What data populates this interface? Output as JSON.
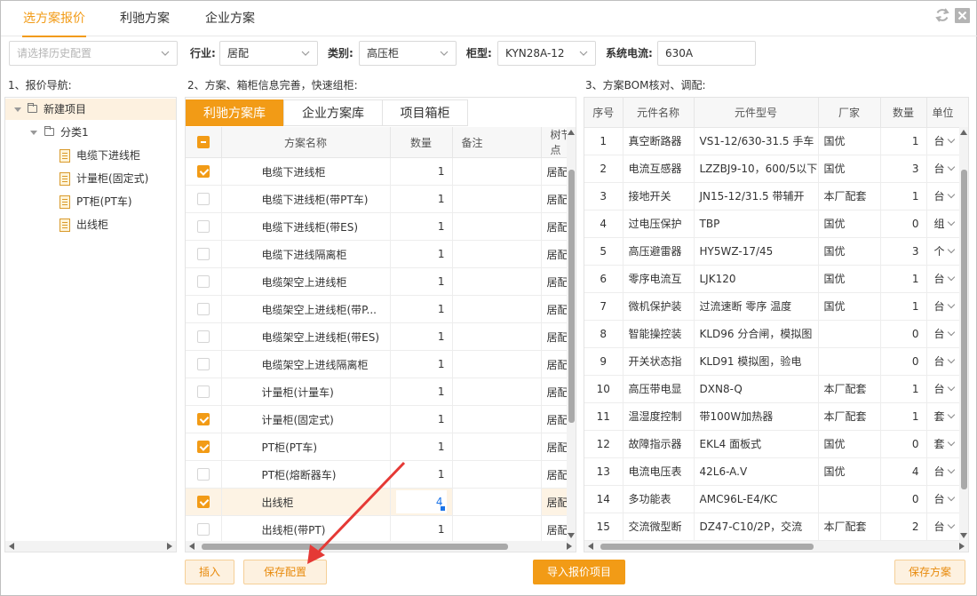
{
  "tabs": [
    {
      "label": "选方案报价",
      "active": true
    },
    {
      "label": "利驰方案"
    },
    {
      "label": "企业方案"
    }
  ],
  "icons": {
    "refresh": "refresh-icon",
    "close": "close-icon"
  },
  "filters": {
    "history_placeholder": "请选择历史配置",
    "industry_label": "行业:",
    "industry_value": "居配",
    "category_label": "类别:",
    "category_value": "高压柜",
    "cabinet_label": "柜型:",
    "cabinet_value": "KYN28A-12",
    "current_label": "系统电流:",
    "current_value": "630A"
  },
  "sections": {
    "nav": "1、报价导航:",
    "scheme": "2、方案、箱柜信息完善，快速组柜:",
    "bom": "3、方案BOM核对、调配:"
  },
  "tree": {
    "root": "新建项目",
    "group": "分类1",
    "items": [
      "电缆下进线柜",
      "计量柜(固定式)",
      "PT柜(PT车)",
      "出线柜"
    ]
  },
  "scheme_tabs": [
    "利驰方案库",
    "企业方案库",
    "项目箱柜"
  ],
  "scheme_table": {
    "headers": [
      "方案名称",
      "数量",
      "备注",
      "树节点"
    ],
    "rows": [
      {
        "checked": true,
        "name": "电缆下进线柜",
        "qty": "1",
        "note": "",
        "node": "居配"
      },
      {
        "checked": false,
        "name": "电缆下进线柜(带PT车)",
        "qty": "1",
        "note": "",
        "node": "居配"
      },
      {
        "checked": false,
        "name": "电缆下进线柜(带ES)",
        "qty": "1",
        "note": "",
        "node": "居配"
      },
      {
        "checked": false,
        "name": "电缆下进线隔离柜",
        "qty": "1",
        "note": "",
        "node": "居配"
      },
      {
        "checked": false,
        "name": "电缆架空上进线柜",
        "qty": "1",
        "note": "",
        "node": "居配"
      },
      {
        "checked": false,
        "name": "电缆架空上进线柜(带P...",
        "qty": "1",
        "note": "",
        "node": "居配"
      },
      {
        "checked": false,
        "name": "电缆架空上进线柜(带ES)",
        "qty": "1",
        "note": "",
        "node": "居配"
      },
      {
        "checked": false,
        "name": "电缆架空上进线隔离柜",
        "qty": "1",
        "note": "",
        "node": "居配"
      },
      {
        "checked": false,
        "name": "计量柜(计量车)",
        "qty": "1",
        "note": "",
        "node": "居配"
      },
      {
        "checked": true,
        "name": "计量柜(固定式)",
        "qty": "1",
        "note": "",
        "node": "居配"
      },
      {
        "checked": true,
        "name": "PT柜(PT车)",
        "qty": "1",
        "note": "",
        "node": "居配"
      },
      {
        "checked": false,
        "name": "PT柜(熔断器车)",
        "qty": "1",
        "note": "",
        "node": "居配"
      },
      {
        "checked": true,
        "name": "出线柜",
        "qty": "4",
        "note": "",
        "node": "居配",
        "editing": true
      },
      {
        "checked": false,
        "name": "出线柜(带PT)",
        "qty": "1",
        "note": "",
        "node": "居配"
      }
    ]
  },
  "bom_table": {
    "headers": [
      "序号",
      "元件名称",
      "元件型号",
      "厂家",
      "数量",
      "单位"
    ],
    "rows": [
      {
        "no": "1",
        "name": "真空断路器",
        "model": "VS1-12/630-31.5 手车",
        "maker": "国优",
        "qty": "1",
        "unit": "台"
      },
      {
        "no": "2",
        "name": "电流互感器",
        "model": "LZZBJ9-10，600/5以下",
        "maker": "国优",
        "qty": "3",
        "unit": "台"
      },
      {
        "no": "3",
        "name": "接地开关",
        "model": "JN15-12/31.5 带辅开",
        "maker": "本厂配套",
        "qty": "1",
        "unit": "台"
      },
      {
        "no": "4",
        "name": "过电压保护",
        "model": "TBP",
        "maker": "国优",
        "qty": "0",
        "unit": "组"
      },
      {
        "no": "5",
        "name": "高压避雷器",
        "model": "HY5WZ-17/45",
        "maker": "国优",
        "qty": "3",
        "unit": "个"
      },
      {
        "no": "6",
        "name": "零序电流互",
        "model": "LJK120",
        "maker": "国优",
        "qty": "1",
        "unit": "台"
      },
      {
        "no": "7",
        "name": "微机保护装",
        "model": "过流速断 零序 温度",
        "maker": "国优",
        "qty": "1",
        "unit": "台"
      },
      {
        "no": "8",
        "name": "智能操控装",
        "model": "KLD96 分合闸，模拟图",
        "maker": "",
        "qty": "0",
        "unit": "台"
      },
      {
        "no": "9",
        "name": "开关状态指",
        "model": "KLD91 模拟图，验电",
        "maker": "",
        "qty": "0",
        "unit": "台"
      },
      {
        "no": "10",
        "name": "高压带电显",
        "model": "DXN8-Q",
        "maker": "本厂配套",
        "qty": "1",
        "unit": "台"
      },
      {
        "no": "11",
        "name": "温湿度控制",
        "model": "带100W加热器",
        "maker": "本厂配套",
        "qty": "1",
        "unit": "套"
      },
      {
        "no": "12",
        "name": "故障指示器",
        "model": "EKL4 面板式",
        "maker": "国优",
        "qty": "0",
        "unit": "套"
      },
      {
        "no": "13",
        "name": "电流电压表",
        "model": "42L6-A.V",
        "maker": "国优",
        "qty": "4",
        "unit": "台"
      },
      {
        "no": "14",
        "name": "多功能表",
        "model": "AMC96L-E4/KC",
        "maker": "",
        "qty": "0",
        "unit": "台"
      },
      {
        "no": "15",
        "name": "交流微型断",
        "model": "DZ47-C10/2P，交流",
        "maker": "本厂配套",
        "qty": "2",
        "unit": "台"
      }
    ]
  },
  "buttons": {
    "insert": "插入",
    "save_config": "保存配置",
    "import": "导入报价项目",
    "save_scheme": "保存方案"
  },
  "colors": {
    "accent": "#f29b16",
    "highlight": "#fdf3e4",
    "annotation_arrow": "#e53935"
  }
}
